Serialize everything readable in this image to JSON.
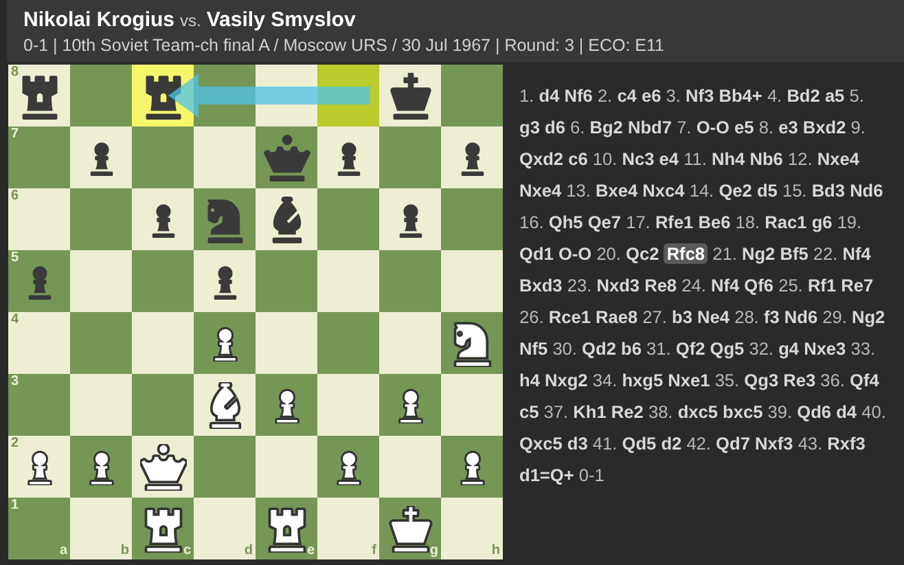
{
  "header": {
    "white_player": "Nikolai Krogius",
    "separator": "vs.",
    "black_player": "Vasily Smyslov",
    "details": "0-1 | 10th Soviet Team-ch final A / Moscow URS / 30 Jul 1967 | Round: 3 | ECO: E11"
  },
  "board": {
    "arrow": true,
    "ranks": [
      {
        "label": "8",
        "squares": [
          {
            "kind": "black-rook",
            "from": false,
            "to": false
          },
          {
            "kind": "empty",
            "from": false,
            "to": false
          },
          {
            "kind": "black-rook",
            "from": false,
            "to": true
          },
          {
            "kind": "empty",
            "from": false,
            "to": false
          },
          {
            "kind": "empty",
            "from": false,
            "to": false
          },
          {
            "kind": "empty",
            "from": true,
            "to": false
          },
          {
            "kind": "black-king",
            "from": false,
            "to": false
          },
          {
            "kind": "empty",
            "from": false,
            "to": false
          }
        ]
      },
      {
        "label": "7",
        "squares": [
          {
            "kind": "empty",
            "from": false,
            "to": false
          },
          {
            "kind": "black-pawn",
            "from": false,
            "to": false
          },
          {
            "kind": "empty",
            "from": false,
            "to": false
          },
          {
            "kind": "empty",
            "from": false,
            "to": false
          },
          {
            "kind": "black-queen",
            "from": false,
            "to": false
          },
          {
            "kind": "black-pawn",
            "from": false,
            "to": false
          },
          {
            "kind": "empty",
            "from": false,
            "to": false
          },
          {
            "kind": "black-pawn",
            "from": false,
            "to": false
          }
        ]
      },
      {
        "label": "6",
        "squares": [
          {
            "kind": "empty",
            "from": false,
            "to": false
          },
          {
            "kind": "empty",
            "from": false,
            "to": false
          },
          {
            "kind": "black-pawn",
            "from": false,
            "to": false
          },
          {
            "kind": "black-knight",
            "from": false,
            "to": false
          },
          {
            "kind": "black-bishop",
            "from": false,
            "to": false
          },
          {
            "kind": "empty",
            "from": false,
            "to": false
          },
          {
            "kind": "black-pawn",
            "from": false,
            "to": false
          },
          {
            "kind": "empty",
            "from": false,
            "to": false
          }
        ]
      },
      {
        "label": "5",
        "squares": [
          {
            "kind": "black-pawn",
            "from": false,
            "to": false
          },
          {
            "kind": "empty",
            "from": false,
            "to": false
          },
          {
            "kind": "empty",
            "from": false,
            "to": false
          },
          {
            "kind": "black-pawn",
            "from": false,
            "to": false
          },
          {
            "kind": "empty",
            "from": false,
            "to": false
          },
          {
            "kind": "empty",
            "from": false,
            "to": false
          },
          {
            "kind": "empty",
            "from": false,
            "to": false
          },
          {
            "kind": "empty",
            "from": false,
            "to": false
          }
        ]
      },
      {
        "label": "4",
        "squares": [
          {
            "kind": "empty",
            "from": false,
            "to": false
          },
          {
            "kind": "empty",
            "from": false,
            "to": false
          },
          {
            "kind": "empty",
            "from": false,
            "to": false
          },
          {
            "kind": "white-pawn",
            "from": false,
            "to": false
          },
          {
            "kind": "empty",
            "from": false,
            "to": false
          },
          {
            "kind": "empty",
            "from": false,
            "to": false
          },
          {
            "kind": "empty",
            "from": false,
            "to": false
          },
          {
            "kind": "white-knight",
            "from": false,
            "to": false
          }
        ]
      },
      {
        "label": "3",
        "squares": [
          {
            "kind": "empty",
            "from": false,
            "to": false
          },
          {
            "kind": "empty",
            "from": false,
            "to": false
          },
          {
            "kind": "empty",
            "from": false,
            "to": false
          },
          {
            "kind": "white-bishop",
            "from": false,
            "to": false
          },
          {
            "kind": "white-pawn",
            "from": false,
            "to": false
          },
          {
            "kind": "empty",
            "from": false,
            "to": false
          },
          {
            "kind": "white-pawn",
            "from": false,
            "to": false
          },
          {
            "kind": "empty",
            "from": false,
            "to": false
          }
        ]
      },
      {
        "label": "2",
        "squares": [
          {
            "kind": "white-pawn",
            "from": false,
            "to": false
          },
          {
            "kind": "white-pawn",
            "from": false,
            "to": false
          },
          {
            "kind": "white-queen",
            "from": false,
            "to": false
          },
          {
            "kind": "empty",
            "from": false,
            "to": false
          },
          {
            "kind": "empty",
            "from": false,
            "to": false
          },
          {
            "kind": "white-pawn",
            "from": false,
            "to": false
          },
          {
            "kind": "empty",
            "from": false,
            "to": false
          },
          {
            "kind": "white-pawn",
            "from": false,
            "to": false
          }
        ]
      },
      {
        "label": "1",
        "squares": [
          {
            "kind": "empty",
            "from": false,
            "to": false
          },
          {
            "kind": "empty",
            "from": false,
            "to": false
          },
          {
            "kind": "white-rook",
            "from": false,
            "to": false
          },
          {
            "kind": "empty",
            "from": false,
            "to": false
          },
          {
            "kind": "white-rook",
            "from": false,
            "to": false
          },
          {
            "kind": "empty",
            "from": false,
            "to": false
          },
          {
            "kind": "white-king",
            "from": false,
            "to": false
          },
          {
            "kind": "empty",
            "from": false,
            "to": false
          }
        ]
      }
    ],
    "files": [
      "a",
      "b",
      "c",
      "d",
      "e",
      "f",
      "g",
      "h"
    ]
  },
  "moves": [
    {
      "number": "1.",
      "plies": [
        {
          "san": "d4",
          "selected": false
        },
        {
          "san": "Nf6",
          "selected": false
        }
      ]
    },
    {
      "number": "2.",
      "plies": [
        {
          "san": "c4",
          "selected": false
        },
        {
          "san": "e6",
          "selected": false
        }
      ]
    },
    {
      "number": "3.",
      "plies": [
        {
          "san": "Nf3",
          "selected": false
        },
        {
          "san": "Bb4+",
          "selected": false
        }
      ]
    },
    {
      "number": "4.",
      "plies": [
        {
          "san": "Bd2",
          "selected": false
        },
        {
          "san": "a5",
          "selected": false
        }
      ]
    },
    {
      "number": "5.",
      "plies": [
        {
          "san": "g3",
          "selected": false
        },
        {
          "san": "d6",
          "selected": false
        }
      ]
    },
    {
      "number": "6.",
      "plies": [
        {
          "san": "Bg2",
          "selected": false
        },
        {
          "san": "Nbd7",
          "selected": false
        }
      ]
    },
    {
      "number": "7.",
      "plies": [
        {
          "san": "O-O",
          "selected": false
        },
        {
          "san": "e5",
          "selected": false
        }
      ]
    },
    {
      "number": "8.",
      "plies": [
        {
          "san": "e3",
          "selected": false
        },
        {
          "san": "Bxd2",
          "selected": false
        }
      ]
    },
    {
      "number": "9.",
      "plies": [
        {
          "san": "Qxd2",
          "selected": false
        },
        {
          "san": "c6",
          "selected": false
        }
      ]
    },
    {
      "number": "10.",
      "plies": [
        {
          "san": "Nc3",
          "selected": false
        },
        {
          "san": "e4",
          "selected": false
        }
      ]
    },
    {
      "number": "11.",
      "plies": [
        {
          "san": "Nh4",
          "selected": false
        },
        {
          "san": "Nb6",
          "selected": false
        }
      ]
    },
    {
      "number": "12.",
      "plies": [
        {
          "san": "Nxe4",
          "selected": false
        },
        {
          "san": "Nxe4",
          "selected": false
        }
      ]
    },
    {
      "number": "13.",
      "plies": [
        {
          "san": "Bxe4",
          "selected": false
        },
        {
          "san": "Nxc4",
          "selected": false
        }
      ]
    },
    {
      "number": "14.",
      "plies": [
        {
          "san": "Qe2",
          "selected": false
        },
        {
          "san": "d5",
          "selected": false
        }
      ]
    },
    {
      "number": "15.",
      "plies": [
        {
          "san": "Bd3",
          "selected": false
        },
        {
          "san": "Nd6",
          "selected": false
        }
      ]
    },
    {
      "number": "16.",
      "plies": [
        {
          "san": "Qh5",
          "selected": false
        },
        {
          "san": "Qe7",
          "selected": false
        }
      ]
    },
    {
      "number": "17.",
      "plies": [
        {
          "san": "Rfe1",
          "selected": false
        },
        {
          "san": "Be6",
          "selected": false
        }
      ]
    },
    {
      "number": "18.",
      "plies": [
        {
          "san": "Rac1",
          "selected": false
        },
        {
          "san": "g6",
          "selected": false
        }
      ]
    },
    {
      "number": "19.",
      "plies": [
        {
          "san": "Qd1",
          "selected": false
        },
        {
          "san": "O-O",
          "selected": false
        }
      ]
    },
    {
      "number": "20.",
      "plies": [
        {
          "san": "Qc2",
          "selected": false
        },
        {
          "san": "Rfc8",
          "selected": true
        }
      ]
    },
    {
      "number": "21.",
      "plies": [
        {
          "san": "Ng2",
          "selected": false
        },
        {
          "san": "Bf5",
          "selected": false
        }
      ]
    },
    {
      "number": "22.",
      "plies": [
        {
          "san": "Nf4",
          "selected": false
        },
        {
          "san": "Bxd3",
          "selected": false
        }
      ]
    },
    {
      "number": "23.",
      "plies": [
        {
          "san": "Nxd3",
          "selected": false
        },
        {
          "san": "Re8",
          "selected": false
        }
      ]
    },
    {
      "number": "24.",
      "plies": [
        {
          "san": "Nf4",
          "selected": false
        },
        {
          "san": "Qf6",
          "selected": false
        }
      ]
    },
    {
      "number": "25.",
      "plies": [
        {
          "san": "Rf1",
          "selected": false
        },
        {
          "san": "Re7",
          "selected": false
        }
      ]
    },
    {
      "number": "26.",
      "plies": [
        {
          "san": "Rce1",
          "selected": false
        },
        {
          "san": "Rae8",
          "selected": false
        }
      ]
    },
    {
      "number": "27.",
      "plies": [
        {
          "san": "b3",
          "selected": false
        },
        {
          "san": "Ne4",
          "selected": false
        }
      ]
    },
    {
      "number": "28.",
      "plies": [
        {
          "san": "f3",
          "selected": false
        },
        {
          "san": "Nd6",
          "selected": false
        }
      ]
    },
    {
      "number": "29.",
      "plies": [
        {
          "san": "Ng2",
          "selected": false
        },
        {
          "san": "Nf5",
          "selected": false
        }
      ]
    },
    {
      "number": "30.",
      "plies": [
        {
          "san": "Qd2",
          "selected": false
        },
        {
          "san": "b6",
          "selected": false
        }
      ]
    },
    {
      "number": "31.",
      "plies": [
        {
          "san": "Qf2",
          "selected": false
        },
        {
          "san": "Qg5",
          "selected": false
        }
      ]
    },
    {
      "number": "32.",
      "plies": [
        {
          "san": "g4",
          "selected": false
        },
        {
          "san": "Nxe3",
          "selected": false
        }
      ]
    },
    {
      "number": "33.",
      "plies": [
        {
          "san": "h4",
          "selected": false
        },
        {
          "san": "Nxg2",
          "selected": false
        }
      ]
    },
    {
      "number": "34.",
      "plies": [
        {
          "san": "hxg5",
          "selected": false
        },
        {
          "san": "Nxe1",
          "selected": false
        }
      ]
    },
    {
      "number": "35.",
      "plies": [
        {
          "san": "Qg3",
          "selected": false
        },
        {
          "san": "Re3",
          "selected": false
        }
      ]
    },
    {
      "number": "36.",
      "plies": [
        {
          "san": "Qf4",
          "selected": false
        },
        {
          "san": "c5",
          "selected": false
        }
      ]
    },
    {
      "number": "37.",
      "plies": [
        {
          "san": "Kh1",
          "selected": false
        },
        {
          "san": "Re2",
          "selected": false
        }
      ]
    },
    {
      "number": "38.",
      "plies": [
        {
          "san": "dxc5",
          "selected": false
        },
        {
          "san": "bxc5",
          "selected": false
        }
      ]
    },
    {
      "number": "39.",
      "plies": [
        {
          "san": "Qd6",
          "selected": false
        },
        {
          "san": "d4",
          "selected": false
        }
      ]
    },
    {
      "number": "40.",
      "plies": [
        {
          "san": "Qxc5",
          "selected": false
        },
        {
          "san": "d3",
          "selected": false
        }
      ]
    },
    {
      "number": "41.",
      "plies": [
        {
          "san": "Qd5",
          "selected": false
        },
        {
          "san": "d2",
          "selected": false
        }
      ]
    },
    {
      "number": "42.",
      "plies": [
        {
          "san": "Qd7",
          "selected": false
        },
        {
          "san": "Nxf3",
          "selected": false
        }
      ]
    },
    {
      "number": "43.",
      "plies": [
        {
          "san": "Rxf3",
          "selected": false
        },
        {
          "san": "d1=Q+",
          "selected": false
        }
      ]
    }
  ],
  "result": "0-1"
}
